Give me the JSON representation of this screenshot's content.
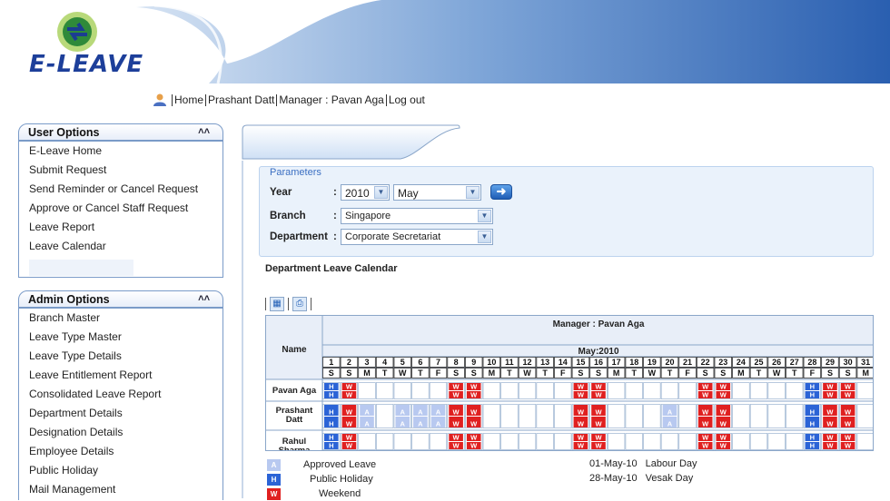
{
  "app": {
    "logo_text": "E-LEAVE"
  },
  "topnav": {
    "home": "Home",
    "user": "Prashant Datt",
    "manager": "Manager : Pavan Aga",
    "logout": "Log out"
  },
  "user_options": {
    "title": "User Options",
    "collapse_icon": "double-chevron-up-icon",
    "items": [
      "E-Leave Home",
      "Submit Request",
      "Send Reminder or Cancel Request",
      "Approve or Cancel Staff Request",
      "Leave Report",
      "Leave Calendar"
    ]
  },
  "admin_options": {
    "title": "Admin Options",
    "collapse_icon": "double-chevron-up-icon",
    "items": [
      "Branch Master",
      "Leave Type Master",
      "Leave Type Details",
      "Leave Entitlement Report",
      "Consolidated Leave Report",
      "Department Details",
      "Designation Details",
      "Employee Details",
      "Public Holiday",
      "Mail Management"
    ]
  },
  "parameters": {
    "legend": "Parameters",
    "year_label": "Year",
    "year_value": "2010",
    "month_value": "May",
    "branch_label": "Branch",
    "branch_value": "Singapore",
    "department_label": "Department",
    "department_value": "Corporate Secretariat",
    "colon": ":"
  },
  "calendar": {
    "section_title": "Department Leave Calendar",
    "manager_header": "Manager : Pavan Aga",
    "name_header": "Name",
    "month_header": "May:2010",
    "days": [
      "1",
      "2",
      "3",
      "4",
      "5",
      "6",
      "7",
      "8",
      "9",
      "10",
      "11",
      "12",
      "13",
      "14",
      "15",
      "16",
      "17",
      "18",
      "19",
      "20",
      "21",
      "22",
      "23",
      "24",
      "25",
      "26",
      "27",
      "28",
      "29",
      "30",
      "31"
    ],
    "weekdays": [
      "S",
      "S",
      "M",
      "T",
      "W",
      "T",
      "F",
      "S",
      "S",
      "M",
      "T",
      "W",
      "T",
      "F",
      "S",
      "S",
      "M",
      "T",
      "W",
      "T",
      "F",
      "S",
      "S",
      "M",
      "T",
      "W",
      "T",
      "F",
      "S",
      "S",
      "M"
    ],
    "employees": [
      {
        "name": "Pavan Aga",
        "approved": []
      },
      {
        "name": "Prashant Datt",
        "approved": [
          3,
          5,
          6,
          7,
          20
        ]
      },
      {
        "name": "Rahul Sharma",
        "approved": []
      }
    ],
    "holidays": [
      1,
      28
    ],
    "weekends": [
      2,
      8,
      9,
      15,
      16,
      22,
      23,
      29,
      30
    ],
    "codes": {
      "approved": "A",
      "holiday": "H",
      "weekend": "W"
    },
    "colors": {
      "approved": "#b8c9f0",
      "holiday": "#2b63d6",
      "weekend": "#e02020",
      "header_bg": "#e8eef8"
    }
  },
  "legend": {
    "approved": "Approved Leave",
    "holiday": "Public Holiday",
    "weekend": "Weekend",
    "holidays_list": [
      {
        "date": "01-May-10",
        "name": "Labour Day"
      },
      {
        "date": "28-May-10",
        "name": "Vesak Day"
      }
    ]
  }
}
